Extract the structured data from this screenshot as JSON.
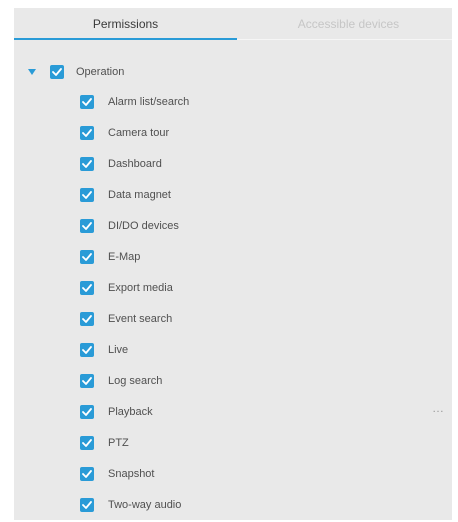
{
  "tabs": {
    "permissions": "Permissions",
    "accessible_devices": "Accessible devices"
  },
  "tree": {
    "root": {
      "label": "Operation",
      "checked": true,
      "expanded": true
    },
    "children": [
      {
        "label": "Alarm list/search",
        "checked": true
      },
      {
        "label": "Camera tour",
        "checked": true
      },
      {
        "label": "Dashboard",
        "checked": true
      },
      {
        "label": "Data magnet",
        "checked": true
      },
      {
        "label": "DI/DO devices",
        "checked": true
      },
      {
        "label": "E-Map",
        "checked": true
      },
      {
        "label": "Export media",
        "checked": true
      },
      {
        "label": "Event search",
        "checked": true
      },
      {
        "label": "Live",
        "checked": true
      },
      {
        "label": "Log search",
        "checked": true
      },
      {
        "label": "Playback",
        "checked": true
      },
      {
        "label": "PTZ",
        "checked": true
      },
      {
        "label": "Snapshot",
        "checked": true
      },
      {
        "label": "Two-way audio",
        "checked": true
      }
    ]
  },
  "more_menu": "…",
  "colors": {
    "accent": "#2a9bd7",
    "panel_background": "#e9e9e9",
    "active_tab_text": "#3a3a3a",
    "inactive_tab_text": "#c6c6c6",
    "label_text": "#505050"
  },
  "icons": {
    "expand": "caret-down-icon",
    "check": "checkmark-icon",
    "more": "more-horizontal-icon"
  }
}
